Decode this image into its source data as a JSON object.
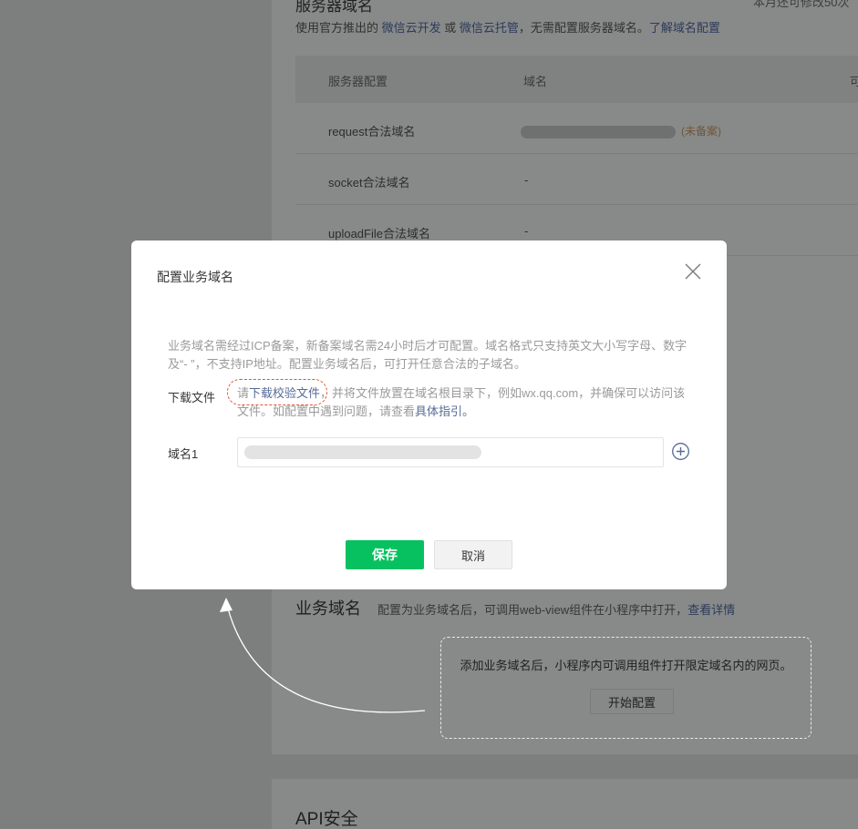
{
  "background": {
    "server_section": {
      "title": "服务器域名",
      "quota": "本月还可修改50次",
      "desc_prefix": "使用官方推出的 ",
      "link_cloud_dev": "微信云开发",
      "desc_or": " 或 ",
      "link_cloud_host": "微信云托管",
      "desc_suffix": "，无需配置服务器域名。",
      "link_learn": "了解域名配置"
    },
    "table": {
      "headers": [
        "服务器配置",
        "域名",
        "可"
      ],
      "rows": [
        {
          "name": "request合法域名",
          "value": "",
          "tag": "(未备案)"
        },
        {
          "name": "socket合法域名",
          "value": "-",
          "tag": ""
        },
        {
          "name": "uploadFile合法域名",
          "value": "-",
          "tag": ""
        }
      ]
    },
    "business_section": {
      "title": "业务域名",
      "desc": "配置为业务域名后，可调用web-view组件在小程序中打开，",
      "link": "查看详情",
      "empty_text": "添加业务域名后，小程序内可调用组件打开限定域名内的网页。",
      "start_button": "开始配置"
    },
    "api_section": {
      "title": "API安全"
    }
  },
  "modal": {
    "title": "配置业务域名",
    "description": "业务域名需经过ICP备案，新备案域名需24小时后才可配置。域名格式只支持英文大小写字母、数字及“- ”，不支持IP地址。配置业务域名后，可打开任意合法的子域名。",
    "download_label": "下载文件",
    "download_prefix": "请",
    "download_link": "下载校验文件",
    "download_middle": "，并将文件放置在域名根目录下，例如wx.qq.com，并确保可以访问该文件。如配置中遇到问题，请查看",
    "guide_link": "具体指引",
    "download_end": "。",
    "domain_label": "域名1",
    "domain_value": "",
    "save_button": "保存",
    "cancel_button": "取消"
  }
}
